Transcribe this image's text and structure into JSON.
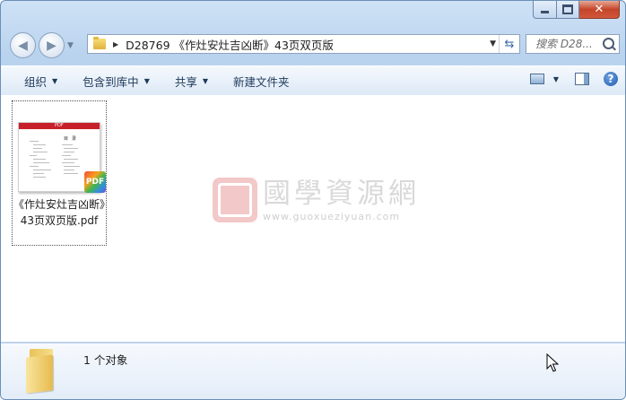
{
  "window": {
    "path_segment": "D28769 《作灶安灶吉凶断》43页双页版"
  },
  "search": {
    "placeholder": "搜索 D28..."
  },
  "commandbar": {
    "organize": "组织",
    "include_in_library": "包含到库中",
    "share": "共享",
    "new_folder": "新建文件夹"
  },
  "files": [
    {
      "name": "《作灶安灶吉凶断》43页双页版.pdf",
      "thumb_header": "PDF",
      "thumb_title": "目录",
      "badge": "PDF"
    }
  ],
  "watermark": {
    "cn": "國學資源網",
    "url": "www.guoxueziyuan.com"
  },
  "status": {
    "count": "1 个对象"
  },
  "icons": [
    "back-arrow-icon",
    "forward-arrow-icon",
    "folder-icon",
    "refresh-icon",
    "search-icon",
    "view-options-icon",
    "preview-pane-icon",
    "help-icon",
    "pdf-icon",
    "large-folder-icon",
    "mouse-cursor-icon"
  ],
  "colors": {
    "accent": "#c8202a"
  }
}
